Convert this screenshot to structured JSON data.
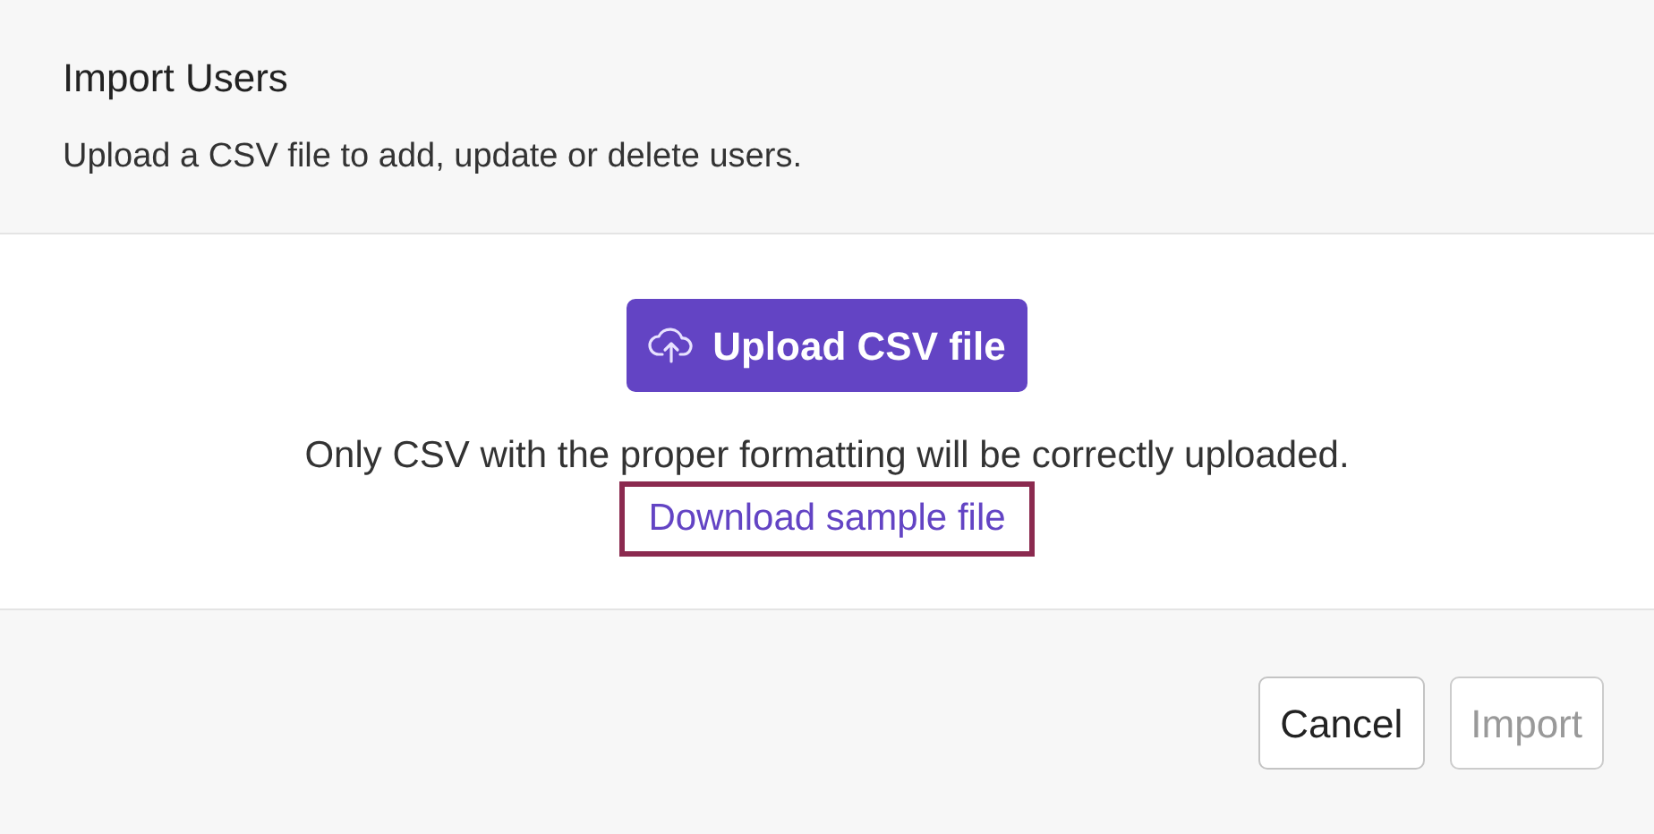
{
  "dialog": {
    "title": "Import Users",
    "subtitle": "Upload a CSV file to add, update or delete users."
  },
  "upload_button": {
    "label": "Upload CSV file"
  },
  "note": "Only CSV with the proper formatting will be correctly uploaded.",
  "sample_link": {
    "label": "Download sample file",
    "highlighted": true
  },
  "buttons": [
    {
      "label": "Cancel",
      "disabled": false
    },
    {
      "label": "Import",
      "disabled": true
    }
  ]
}
